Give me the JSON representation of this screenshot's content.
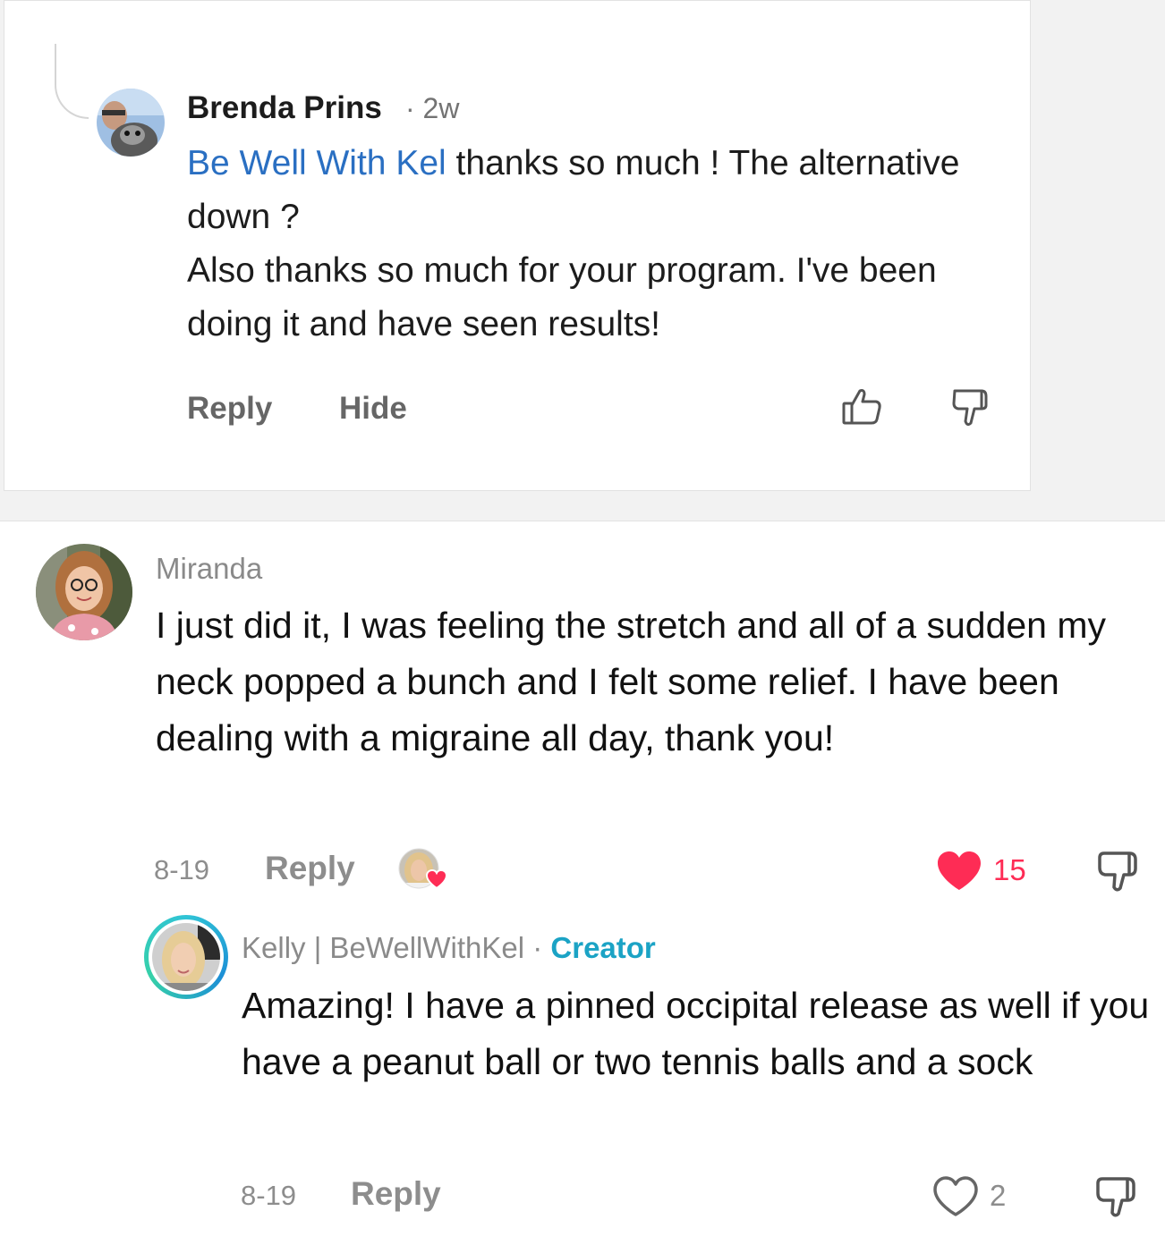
{
  "facebook_reply": {
    "author": "Brenda Prins",
    "time": "· 2w",
    "mention": "Be Well With Kel",
    "text_line_1": " thanks so much ! The alternative down ?",
    "text_line_2": "Also thanks so much for your program.   I've been doing it and have seen results!",
    "reply_label": "Reply",
    "hide_label": "Hide",
    "icons": [
      "thumbs-up-icon",
      "thumbs-down-icon"
    ]
  },
  "tiktok_comment": {
    "author": "Miranda",
    "text": "I just did it, I was feeling the stretch and all of a sudden my neck popped a bunch and I felt some relief. I have been dealing with a migraine all day, thank you!",
    "date": "8-19",
    "reply_label": "Reply",
    "likes": "15",
    "like_color": "#fe2c55",
    "creator_liked": true,
    "reply": {
      "author": "Kelly | BeWellWithKel",
      "separator": "·",
      "badge": "Creator",
      "text": "Amazing! I have a pinned occipital release as well if you have a peanut ball or two tennis balls and a sock",
      "date": "8-19",
      "reply_label": "Reply",
      "likes": "2"
    }
  }
}
